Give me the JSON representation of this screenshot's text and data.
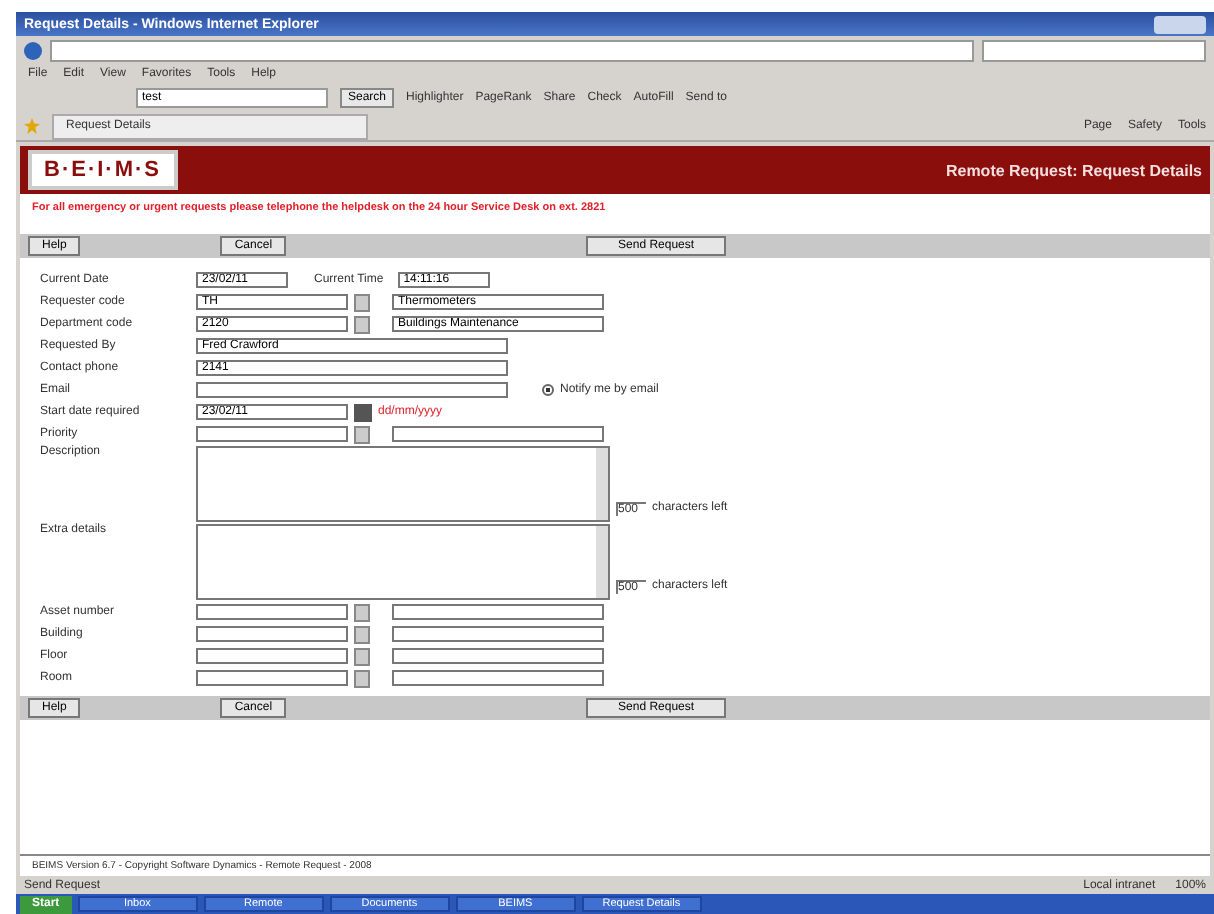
{
  "window": {
    "title": "Request Details - Windows Internet Explorer"
  },
  "menu": [
    "File",
    "Edit",
    "View",
    "Favorites",
    "Tools",
    "Help"
  ],
  "toolbar": {
    "search_value": "test",
    "search_button": "Search",
    "links": [
      "Highlighter",
      "PageRank",
      "Share",
      "Check",
      "AutoFill",
      "Send to"
    ]
  },
  "tab": {
    "title": "Request Details"
  },
  "command_bar": [
    "Page",
    "Safety",
    "Tools"
  ],
  "header": {
    "logo": "B·E·I·M·S",
    "title": "Remote Request: Request Details"
  },
  "warning": "**For all emergency or urgent requests please telephone the helpdesk on the 24 hour Service Desk on ext. 2821**",
  "buttons_top": [
    {
      "label": "Help",
      "kind": "small"
    },
    {
      "label": "Cancel",
      "kind": "small"
    },
    {
      "label": "Send Request",
      "kind": "wide"
    }
  ],
  "form": [
    {
      "kind": "datetime",
      "label": "Current Date",
      "value": "23/02/11",
      "label2": "Current Time",
      "value2": "14:11:16"
    },
    {
      "kind": "lookup",
      "label": "Requester code",
      "value": "TH",
      "description": "Thermometers"
    },
    {
      "kind": "lookup",
      "label": "Department code",
      "value": "2120",
      "description": "Buildings Maintenance"
    },
    {
      "kind": "text",
      "label": "Requested By",
      "value": "Fred Crawford"
    },
    {
      "kind": "text",
      "label": "Contact phone",
      "value": "2141"
    },
    {
      "kind": "email",
      "label": "Email",
      "option": "Notify me by email",
      "checked": true
    },
    {
      "kind": "date",
      "label": "Start date required",
      "value": "23/02/11",
      "hint": "dd/mm/yyyy"
    },
    {
      "kind": "lookup",
      "label": "Priority"
    },
    {
      "kind": "area",
      "label": "Description",
      "counter": "500",
      "counter_label": "characters left"
    },
    {
      "kind": "area",
      "label": "Extra details",
      "counter": "500",
      "counter_label": "characters left"
    },
    {
      "kind": "lookup",
      "label": "Asset number"
    },
    {
      "kind": "lookup",
      "label": "Building"
    },
    {
      "kind": "lookup",
      "label": "Floor"
    },
    {
      "kind": "lookup",
      "label": "Room"
    }
  ],
  "buttons_bottom": [
    {
      "label": "Help",
      "kind": "small"
    },
    {
      "label": "Cancel",
      "kind": "small"
    },
    {
      "label": "Send Request",
      "kind": "wide"
    }
  ],
  "footer": "BEIMS Version 6.7 - Copyright Software Dynamics - Remote Request - 2008",
  "status_bar": {
    "text": "Send Request",
    "zone": "Local intranet",
    "zoom": "100%"
  },
  "taskbar": {
    "start": "Start",
    "items": [
      "Inbox",
      "Remote",
      "Documents",
      "BEIMS",
      "Request Details"
    ]
  }
}
